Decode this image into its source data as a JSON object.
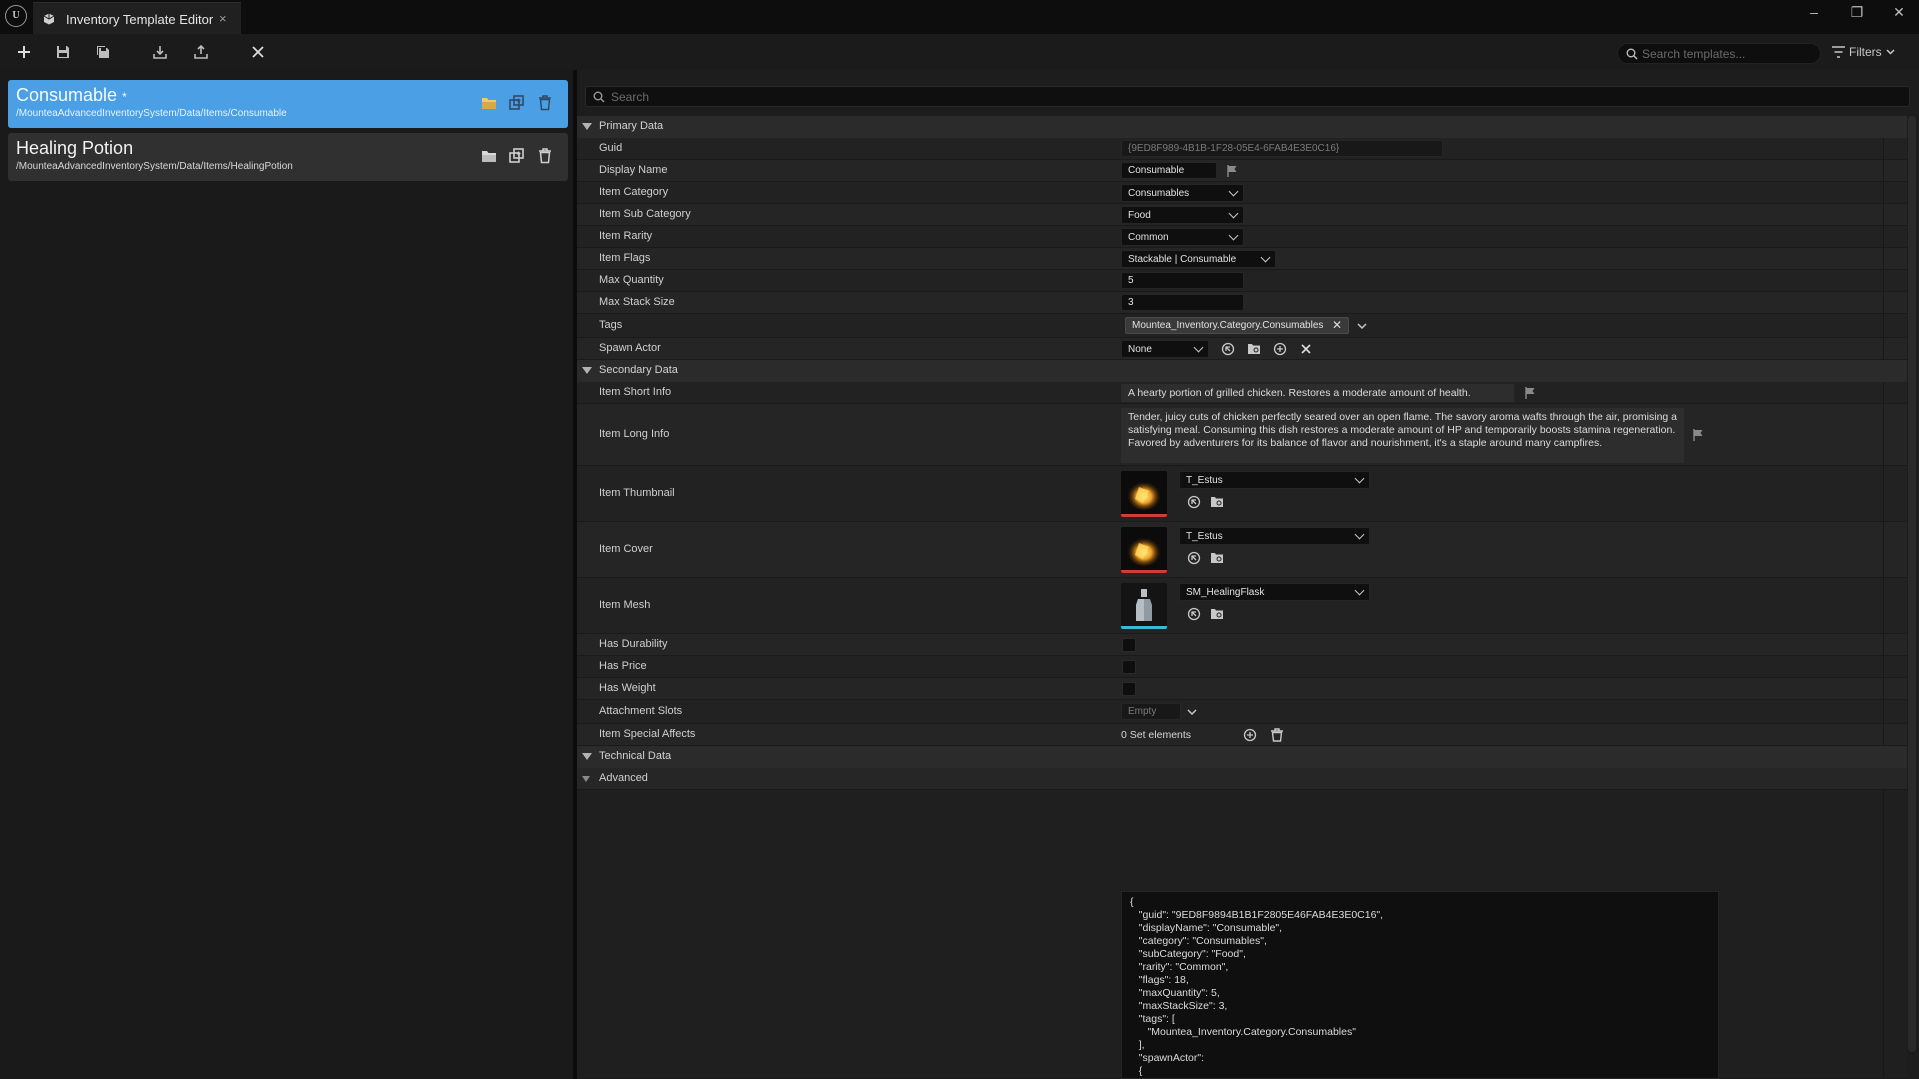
{
  "window": {
    "tab_title": "Inventory Template Editor",
    "tab_close": "×",
    "minimize": "–",
    "restore": "❐",
    "close": "✕"
  },
  "toolbar": {
    "search_placeholder": "Search templates...",
    "filters_label": "Filters"
  },
  "templates": [
    {
      "name": "Consumable",
      "modified_marker": "*",
      "path": "/MounteaAdvancedInventorySystem/Data/Items/Consumable"
    },
    {
      "name": "Healing Potion",
      "path": "/MounteaAdvancedInventorySystem/Data/Items/HealingPotion"
    }
  ],
  "details": {
    "search_placeholder": "Search",
    "sections": {
      "primary": "Primary Data",
      "secondary": "Secondary Data",
      "technical": "Technical Data",
      "advanced": "Advanced"
    },
    "labels": {
      "guid": "Guid",
      "display_name": "Display Name",
      "item_category": "Item Category",
      "item_sub_category": "Item Sub Category",
      "item_rarity": "Item Rarity",
      "item_flags": "Item Flags",
      "max_quantity": "Max Quantity",
      "max_stack_size": "Max Stack Size",
      "tags": "Tags",
      "spawn_actor": "Spawn Actor",
      "item_short_info": "Item Short Info",
      "item_long_info": "Item Long Info",
      "item_thumbnail": "Item Thumbnail",
      "item_cover": "Item Cover",
      "item_mesh": "Item Mesh",
      "has_durability": "Has Durability",
      "has_price": "Has Price",
      "has_weight": "Has Weight",
      "attachment_slots": "Attachment Slots",
      "item_special_affects": "Item Special Affects"
    },
    "values": {
      "guid": "{9ED8F989-4B1B-1F28-05E4-6FAB4E3E0C16}",
      "display_name": "Consumable",
      "item_category": "Consumables",
      "item_sub_category": "Food",
      "item_rarity": "Common",
      "item_flags": "Stackable | Consumable",
      "max_quantity": "5",
      "max_stack_size": "3",
      "tag": "Mountea_Inventory.Category.Consumables",
      "spawn_actor": "None",
      "item_short_info": "A hearty portion of grilled chicken. Restores a moderate amount of health.",
      "item_long_info": "Tender, juicy cuts of chicken perfectly seared over an open flame. The savory aroma wafts through the air, promising a satisfying meal. Consuming this dish restores a moderate amount of HP and temporarily boosts stamina regeneration. Favored by adventurers for its balance of flavor and nourishment, it's a staple around many campfires.",
      "item_thumbnail": "T_Estus",
      "item_cover": "T_Estus",
      "item_mesh": "SM_HealingFlask",
      "has_durability": false,
      "has_price": false,
      "has_weight": false,
      "attachment_slots": "Empty",
      "item_special_affects": "0 Set elements"
    },
    "json_text": "{\n   \"guid\": \"9ED8F9894B1B1F2805E46FAB4E3E0C16\",\n   \"displayName\": \"Consumable\",\n   \"category\": \"Consumables\",\n   \"subCategory\": \"Food\",\n   \"rarity\": \"Common\",\n   \"flags\": 18,\n   \"maxQuantity\": 5,\n   \"maxStackSize\": 3,\n   \"tags\": [\n      \"Mountea_Inventory.Category.Consumables\"\n   ],\n   \"spawnActor\":\n   {\n      \"name\": \"\""
  },
  "colors": {
    "accent": "#4a9fe5",
    "thumbnail_bar": "#d43a3a",
    "mesh_bar": "#3ab8d4"
  }
}
